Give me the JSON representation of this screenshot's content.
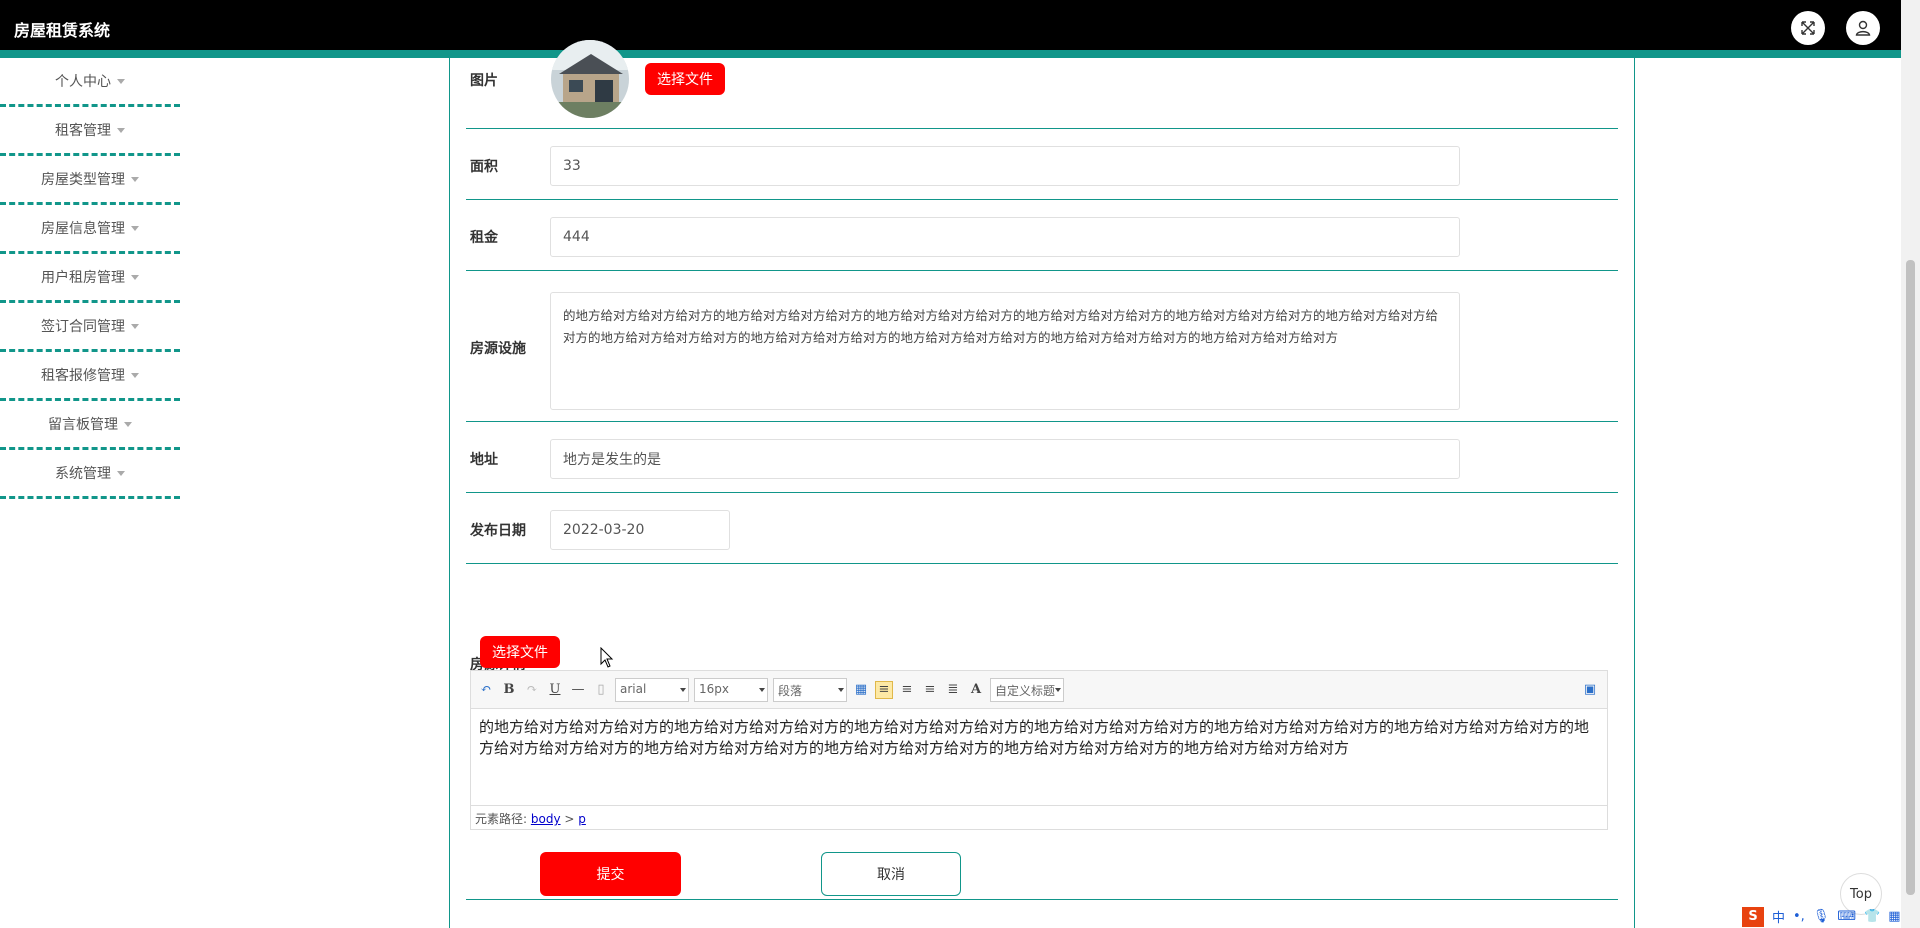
{
  "app": {
    "title": "房屋租赁系统"
  },
  "sidebar": {
    "items": [
      {
        "label": "个人中心"
      },
      {
        "label": "租客管理"
      },
      {
        "label": "房屋类型管理"
      },
      {
        "label": "房屋信息管理"
      },
      {
        "label": "用户租房管理"
      },
      {
        "label": "签订合同管理"
      },
      {
        "label": "租客报修管理"
      },
      {
        "label": "留言板管理"
      },
      {
        "label": "系统管理"
      }
    ]
  },
  "form": {
    "image": {
      "label": "图片",
      "button": "选择文件"
    },
    "area": {
      "label": "面积",
      "value": "33"
    },
    "rent": {
      "label": "租金",
      "value": "444"
    },
    "facilities": {
      "label": "房源设施",
      "value": "的地方给对方给对方给对方的地方给对方给对方给对方的地方给对方给对方给对方的地方给对方给对方给对方的地方给对方给对方给对方的地方给对方给对方给对方的地方给对方给对方给对方的地方给对方给对方给对方的地方给对方给对方给对方的地方给对方给对方给对方的地方给对方给对方给对方"
    },
    "address": {
      "label": "地址",
      "value": "地方是发生的是"
    },
    "publish_date": {
      "label": "发布日期",
      "value": "2022-03-20"
    },
    "details": {
      "label": "房源详情",
      "button": "选择文件",
      "toolbar": {
        "font": "arial",
        "size": "16px",
        "paragraph": "段落",
        "custom_title": "自定义标题"
      },
      "content": "的地方给对方给对方给对方的地方给对方给对方给对方的地方给对方给对方给对方的地方给对方给对方给对方的地方给对方给对方给对方的地方给对方给对方给对方的地方给对方给对方给对方的地方给对方给对方给对方的地方给对方给对方给对方的地方给对方给对方给对方的地方给对方给对方给对方",
      "path_label": "元素路径:",
      "path_body": "body",
      "path_sep": ">",
      "path_p": "p"
    },
    "submit": "提交",
    "cancel": "取消"
  },
  "float": {
    "top": "Top"
  },
  "ime": {
    "lang": "中"
  },
  "colors": {
    "accent": "#11968a",
    "primary_button": "#ff0000",
    "topbar": "#000000"
  }
}
